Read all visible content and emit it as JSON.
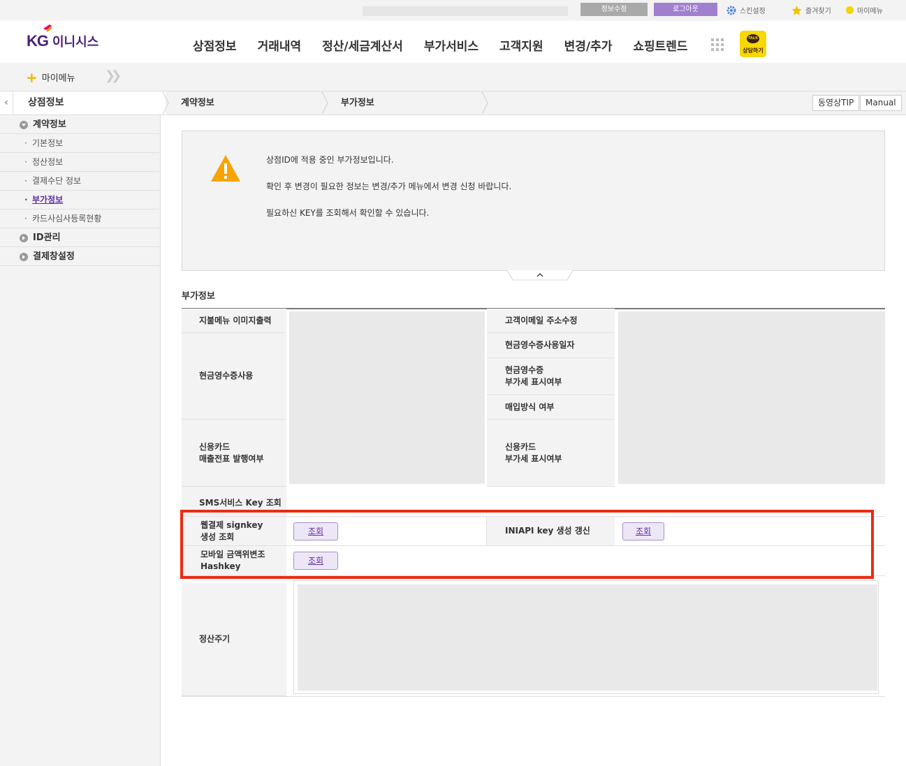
{
  "topbar": {
    "info_edit": "정보수정",
    "logout": "로그아웃",
    "skin": "스킨설정",
    "favorites": "즐겨찾기",
    "mymenu": "마이메뉴"
  },
  "header": {
    "logo_kg": "KG",
    "logo_name": "이니시스",
    "nav": [
      "상점정보",
      "거래내역",
      "정산/세금계산서",
      "부가서비스",
      "고객지원",
      "변경/추가",
      "쇼핑트렌드"
    ],
    "talk_bubble": "TALK",
    "talk_label": "상담하기"
  },
  "mymenu_bar": {
    "label": "마이메뉴"
  },
  "breadcrumb": {
    "level1": "상점정보",
    "level2": "계약정보",
    "level3": "부가정보",
    "video_tip": "동영상TIP",
    "manual": "Manual"
  },
  "sidebar": {
    "group_contract": "계약정보",
    "items": [
      "기본정보",
      "정산정보",
      "결제수단 정보",
      "부가정보",
      "카드사심사등록현황"
    ],
    "group_id": "ID관리",
    "group_payment": "결제창설정"
  },
  "notice": {
    "line1": "상점ID에 적용 중인 부가정보입니다.",
    "line2": "확인 후 변경이 필요한 정보는 변경/추가 메뉴에서 변경 신청 바랍니다.",
    "line3": "필요하신 KEY를 조회해서 확인할 수 있습니다."
  },
  "section": {
    "title": "부가정보",
    "labels": {
      "pay_menu_image": "지불메뉴 이미지출력",
      "cash_receipt_use": "현금영수증사용",
      "credit_card_line1": "신용카드",
      "credit_card_line2": "매출전표 발행여부",
      "customer_email": "고객이메일 주소수정",
      "cash_receipt_date": "현금영수증사용일자",
      "cash_vat_line1": "현금영수증",
      "cash_vat_line2": "부가세 표시여부",
      "purchase_method": "매입방식 여부",
      "card_vat_line1": "신용카드",
      "card_vat_line2": "부가세 표시여부",
      "sms_key": "SMS서비스 Key 조회",
      "web_signkey_line1": "웹결제 signkey",
      "web_signkey_line2": "생성 조회",
      "iniapi_key": "INIAPI key 생성 갱신",
      "mobile_hash_line1": "모바일 금액위변조",
      "mobile_hash_line2": "Hashkey",
      "settlement_cycle": "정산주기"
    },
    "query_button": "조회"
  }
}
